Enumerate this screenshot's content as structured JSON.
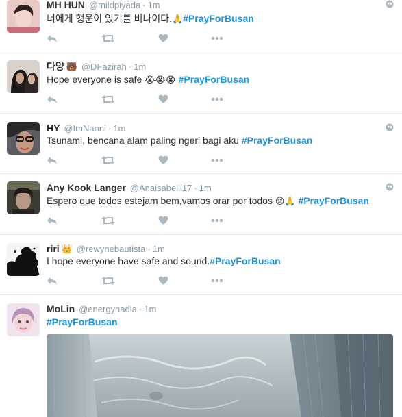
{
  "colors": {
    "hashtag": "#1b95e0",
    "meta": "#8899a6",
    "text": "#292f33",
    "icon": "#aab8c2",
    "divider": "#e1e8ed"
  },
  "tweets": [
    {
      "name": "MH HUN",
      "handle": "@mildpiyada",
      "time": "1m",
      "text_before": "너에게 행운이 있기를 비나이다.",
      "emoji": "🙏",
      "hashtag": "#PrayForBusan",
      "icons": [
        "globe-icon"
      ]
    },
    {
      "name": "다양",
      "name_emoji": "🐻",
      "handle": "@DFazirah",
      "time": "1m",
      "text_before": "Hope everyone is safe",
      "emoji": "😭😭😭",
      "hashtag": "#PrayForBusan"
    },
    {
      "name": "HY",
      "handle": "@ImNanni",
      "time": "1m",
      "text_before": "Tsunami, bencana alam paling ngeri bagi aku",
      "emoji": "",
      "hashtag": "#PrayForBusan",
      "icons": [
        "globe-icon"
      ]
    },
    {
      "name": "Any Kook Langer",
      "handle": "@Anaisabelli17",
      "time": "1m",
      "text_before": "Espero que todos estejam bem,vamos orar por todos",
      "emoji": "😔🙏",
      "hashtag": "#PrayForBusan",
      "icons": [
        "globe-icon"
      ]
    },
    {
      "name": "riri",
      "name_emoji": "👑",
      "handle": "@rewynebautista",
      "time": "1m",
      "text_before": "I hope everyone have safe and sound.",
      "emoji": "",
      "hashtag": "#PrayForBusan"
    },
    {
      "name": "MoLin",
      "handle": "@energynadia",
      "time": "1m",
      "text_before": "",
      "emoji": "",
      "hashtag": "#PrayForBusan"
    }
  ],
  "actions": [
    "reply-icon",
    "retweet-icon",
    "like-icon",
    "more-icon"
  ],
  "separator": "·"
}
